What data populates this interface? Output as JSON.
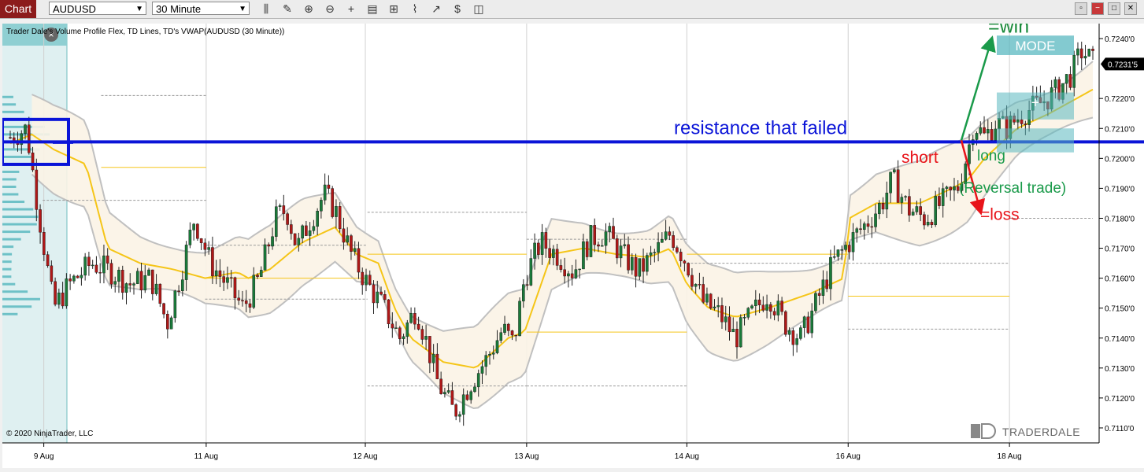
{
  "toolbar": {
    "tab_label": "Chart",
    "instrument": "AUDUSD",
    "interval": "30 Minute",
    "tools": [
      {
        "name": "bar-chart-icon",
        "glyph": "⫼"
      },
      {
        "name": "pencil-icon",
        "glyph": "✎"
      },
      {
        "name": "zoom-in-icon",
        "glyph": "⊕"
      },
      {
        "name": "zoom-out-icon",
        "glyph": "⊖"
      },
      {
        "name": "crosshair-icon",
        "glyph": "+"
      },
      {
        "name": "properties-icon",
        "glyph": "▤"
      },
      {
        "name": "strategy-icon",
        "glyph": "⊞"
      },
      {
        "name": "indicator-icon",
        "glyph": "⌇"
      },
      {
        "name": "drawing-icon",
        "glyph": "↗"
      },
      {
        "name": "template-icon",
        "glyph": "$"
      },
      {
        "name": "window-icon",
        "glyph": "◫"
      }
    ],
    "window_buttons": [
      "▫",
      "−",
      "□",
      "✕"
    ]
  },
  "chart_data": {
    "type": "candlestick",
    "title": "Trader Dale's Volume Profile Flex, TD Lines, TD's VWAP(AUDUSD (30 Minute))",
    "copyright": "© 2020 NinjaTrader, LLC",
    "brand": "TRADERDALE",
    "ylim": [
      0.7105,
      0.7245
    ],
    "y_ticks": [
      "0.7110'0",
      "0.7120'0",
      "0.7130'0",
      "0.7140'0",
      "0.7150'0",
      "0.7160'0",
      "0.7170'0",
      "0.7180'0",
      "0.7190'0",
      "0.7200'0",
      "0.7210'0",
      "0.7220'0",
      "0.7240'0"
    ],
    "y_tick_values": [
      0.711,
      0.712,
      0.713,
      0.714,
      0.715,
      0.716,
      0.717,
      0.718,
      0.719,
      0.72,
      0.721,
      0.722,
      0.724
    ],
    "current_price_label": "0.7231'5",
    "current_price": 0.72315,
    "x_ticks": [
      {
        "label": "9 Aug",
        "t": 0.031
      },
      {
        "label": "11 Aug",
        "t": 0.181
      },
      {
        "label": "12 Aug",
        "t": 0.328
      },
      {
        "label": "13 Aug",
        "t": 0.477
      },
      {
        "label": "14 Aug",
        "t": 0.625
      },
      {
        "label": "16 Aug",
        "t": 0.774
      },
      {
        "label": "18 Aug",
        "t": 0.923
      }
    ],
    "price_path": [
      [
        0.0,
        0.7207
      ],
      [
        0.015,
        0.721
      ],
      [
        0.025,
        0.7185
      ],
      [
        0.04,
        0.715
      ],
      [
        0.055,
        0.7158
      ],
      [
        0.075,
        0.7165
      ],
      [
        0.095,
        0.7162
      ],
      [
        0.11,
        0.7158
      ],
      [
        0.13,
        0.716
      ],
      [
        0.145,
        0.7145
      ],
      [
        0.16,
        0.7165
      ],
      [
        0.17,
        0.718
      ],
      [
        0.185,
        0.7165
      ],
      [
        0.2,
        0.7158
      ],
      [
        0.215,
        0.715
      ],
      [
        0.23,
        0.716
      ],
      [
        0.245,
        0.718
      ],
      [
        0.255,
        0.7183
      ],
      [
        0.265,
        0.717
      ],
      [
        0.275,
        0.7178
      ],
      [
        0.29,
        0.7188
      ],
      [
        0.3,
        0.7183
      ],
      [
        0.315,
        0.7168
      ],
      [
        0.33,
        0.7158
      ],
      [
        0.345,
        0.715
      ],
      [
        0.36,
        0.714
      ],
      [
        0.375,
        0.715
      ],
      [
        0.385,
        0.7138
      ],
      [
        0.395,
        0.7125
      ],
      [
        0.41,
        0.7115
      ],
      [
        0.425,
        0.7125
      ],
      [
        0.44,
        0.7133
      ],
      [
        0.455,
        0.7143
      ],
      [
        0.465,
        0.7138
      ],
      [
        0.475,
        0.716
      ],
      [
        0.49,
        0.7172
      ],
      [
        0.505,
        0.7168
      ],
      [
        0.52,
        0.7162
      ],
      [
        0.535,
        0.7173
      ],
      [
        0.55,
        0.7175
      ],
      [
        0.565,
        0.7168
      ],
      [
        0.58,
        0.7162
      ],
      [
        0.595,
        0.7168
      ],
      [
        0.61,
        0.7175
      ],
      [
        0.625,
        0.7165
      ],
      [
        0.64,
        0.7152
      ],
      [
        0.655,
        0.7148
      ],
      [
        0.67,
        0.714
      ],
      [
        0.685,
        0.7148
      ],
      [
        0.7,
        0.7155
      ],
      [
        0.715,
        0.7145
      ],
      [
        0.73,
        0.714
      ],
      [
        0.745,
        0.7152
      ],
      [
        0.76,
        0.7165
      ],
      [
        0.775,
        0.7172
      ],
      [
        0.79,
        0.7178
      ],
      [
        0.805,
        0.7185
      ],
      [
        0.815,
        0.7193
      ],
      [
        0.83,
        0.7183
      ],
      [
        0.845,
        0.718
      ],
      [
        0.86,
        0.7185
      ],
      [
        0.875,
        0.719
      ],
      [
        0.885,
        0.7203
      ],
      [
        0.89,
        0.7212
      ],
      [
        0.9,
        0.7207
      ],
      [
        0.91,
        0.7212
      ],
      [
        0.92,
        0.721
      ],
      [
        0.935,
        0.7215
      ],
      [
        0.95,
        0.7218
      ],
      [
        0.965,
        0.7222
      ],
      [
        0.98,
        0.7228
      ],
      [
        0.99,
        0.7236
      ],
      [
        1.0,
        0.7232
      ]
    ],
    "vwap_path": [
      [
        0.0,
        0.7205
      ],
      [
        0.02,
        0.7208
      ],
      [
        0.04,
        0.7203
      ],
      [
        0.07,
        0.7198
      ],
      [
        0.09,
        0.717
      ],
      [
        0.12,
        0.7165
      ],
      [
        0.15,
        0.7163
      ],
      [
        0.18,
        0.716
      ],
      [
        0.21,
        0.7162
      ],
      [
        0.22,
        0.716
      ],
      [
        0.24,
        0.7163
      ],
      [
        0.27,
        0.7172
      ],
      [
        0.3,
        0.7177
      ],
      [
        0.32,
        0.7168
      ],
      [
        0.34,
        0.7165
      ],
      [
        0.355,
        0.715
      ],
      [
        0.37,
        0.714
      ],
      [
        0.4,
        0.7132
      ],
      [
        0.43,
        0.713
      ],
      [
        0.46,
        0.714
      ],
      [
        0.475,
        0.7142
      ],
      [
        0.5,
        0.7168
      ],
      [
        0.53,
        0.717
      ],
      [
        0.56,
        0.7168
      ],
      [
        0.59,
        0.7167
      ],
      [
        0.61,
        0.717
      ],
      [
        0.625,
        0.7158
      ],
      [
        0.645,
        0.715
      ],
      [
        0.67,
        0.7147
      ],
      [
        0.7,
        0.715
      ],
      [
        0.74,
        0.7155
      ],
      [
        0.77,
        0.716
      ],
      [
        0.775,
        0.718
      ],
      [
        0.8,
        0.7185
      ],
      [
        0.84,
        0.7185
      ],
      [
        0.87,
        0.719
      ],
      [
        0.885,
        0.7193
      ],
      [
        0.9,
        0.72
      ],
      [
        0.93,
        0.721
      ],
      [
        0.96,
        0.7215
      ],
      [
        1.0,
        0.7223
      ]
    ],
    "annotations": {
      "resistance_text": "resistance that failed",
      "resistance_level": 0.72055,
      "short_text": "short",
      "long_text": "long",
      "reversal_text": "(Reversal trade)",
      "win_text": "=win",
      "loss_text": "=loss",
      "mode_text": "MODE",
      "plus_text": "+"
    },
    "colors": {
      "resistance": "#0a14d8",
      "short": "#e8141a",
      "long": "#1a9a4a",
      "win": "#1a8a3a",
      "vwap": "#f5c518",
      "volume_profile": "#5ab8c0",
      "up_candle": "#1a7a3a",
      "down_candle": "#b01818",
      "band": "#c0c0c0"
    }
  }
}
